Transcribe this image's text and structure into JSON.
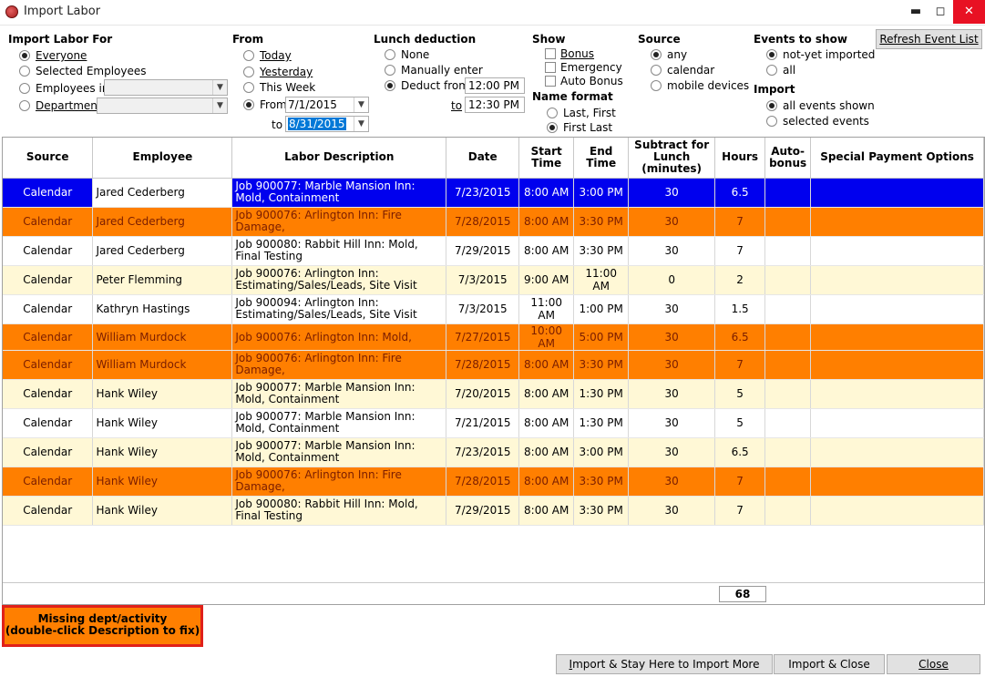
{
  "window": {
    "title": "Import Labor",
    "min": "▬",
    "max": "◻",
    "close": "✕"
  },
  "import_for": {
    "title": "Import Labor For",
    "options": [
      "Everyone",
      "Selected Employees",
      "Employees in",
      "Department"
    ],
    "selected": 0
  },
  "from": {
    "title": "From",
    "options": [
      "Today",
      "Yesterday",
      "This Week",
      "From"
    ],
    "selected": 3,
    "from_date": "7/1/2015",
    "to_label": "to",
    "to_date": "8/31/2015"
  },
  "lunch": {
    "title": "Lunch deduction",
    "options": [
      "None",
      "Manually enter",
      "Deduct from"
    ],
    "selected": 2,
    "from_time": "12:00 PM",
    "to_label": "to",
    "to_time": "12:30 PM"
  },
  "show": {
    "title": "Show",
    "checks": [
      "Bonus",
      "Emergency",
      "Auto Bonus"
    ]
  },
  "name_format": {
    "title": "Name format",
    "options": [
      "Last, First",
      "First Last"
    ],
    "selected": 1
  },
  "source": {
    "title": "Source",
    "options": [
      "any",
      "calendar",
      "mobile devices"
    ],
    "selected": 0
  },
  "events": {
    "title": "Events to show",
    "options": [
      "not-yet imported",
      "all"
    ],
    "selected": 0
  },
  "import_sel": {
    "title": "Import",
    "options": [
      "all events shown",
      "selected events"
    ],
    "selected": 0
  },
  "refresh_label": "Refresh Event List",
  "table": {
    "headers": [
      "Source",
      "Employee",
      "Labor Description",
      "Date",
      "Start Time",
      "End Time",
      "Subtract for Lunch (minutes)",
      "Hours",
      "Auto-bonus",
      "Special Payment Options"
    ],
    "rows": [
      {
        "source": "Calendar",
        "employee": "Jared Cederberg",
        "desc": "Job 900077: Marble Mansion Inn: Mold, Containment",
        "date": "7/23/2015",
        "start": "8:00 AM",
        "end": "3:00 PM",
        "lunch": "30",
        "hours": "6.5",
        "style": "sel"
      },
      {
        "source": "Calendar",
        "employee": "Jared Cederberg",
        "desc": "Job 900076: Arlington Inn: Fire Damage,",
        "date": "7/28/2015",
        "start": "8:00 AM",
        "end": "3:30 PM",
        "lunch": "30",
        "hours": "7",
        "style": "orange"
      },
      {
        "source": "Calendar",
        "employee": "Jared Cederberg",
        "desc": "Job 900080: Rabbit Hill Inn: Mold, Final Testing",
        "date": "7/29/2015",
        "start": "8:00 AM",
        "end": "3:30 PM",
        "lunch": "30",
        "hours": "7",
        "style": "white"
      },
      {
        "source": "Calendar",
        "employee": "Peter Flemming",
        "desc": "Job 900076: Arlington Inn: Estimating/Sales/Leads, Site Visit",
        "date": "7/3/2015",
        "start": "9:00 AM",
        "end": "11:00 AM",
        "lunch": "0",
        "hours": "2",
        "style": "cream"
      },
      {
        "source": "Calendar",
        "employee": "Kathryn Hastings",
        "desc": "Job 900094: Arlington Inn: Estimating/Sales/Leads, Site Visit",
        "date": "7/3/2015",
        "start": "11:00 AM",
        "end": "1:00 PM",
        "lunch": "30",
        "hours": "1.5",
        "style": "white"
      },
      {
        "source": "Calendar",
        "employee": "William Murdock",
        "desc": "Job 900076: Arlington Inn: Mold,",
        "date": "7/27/2015",
        "start": "10:00 AM",
        "end": "5:00 PM",
        "lunch": "30",
        "hours": "6.5",
        "style": "orange short"
      },
      {
        "source": "Calendar",
        "employee": "William Murdock",
        "desc": "Job 900076: Arlington Inn: Fire Damage,",
        "date": "7/28/2015",
        "start": "8:00 AM",
        "end": "3:30 PM",
        "lunch": "30",
        "hours": "7",
        "style": "orange"
      },
      {
        "source": "Calendar",
        "employee": "Hank Wiley",
        "desc": "Job 900077: Marble Mansion Inn: Mold, Containment",
        "date": "7/20/2015",
        "start": "8:00 AM",
        "end": "1:30 PM",
        "lunch": "30",
        "hours": "5",
        "style": "cream"
      },
      {
        "source": "Calendar",
        "employee": "Hank Wiley",
        "desc": "Job 900077: Marble Mansion Inn: Mold, Containment",
        "date": "7/21/2015",
        "start": "8:00 AM",
        "end": "1:30 PM",
        "lunch": "30",
        "hours": "5",
        "style": "white"
      },
      {
        "source": "Calendar",
        "employee": "Hank Wiley",
        "desc": "Job 900077: Marble Mansion Inn: Mold, Containment",
        "date": "7/23/2015",
        "start": "8:00 AM",
        "end": "3:00 PM",
        "lunch": "30",
        "hours": "6.5",
        "style": "cream"
      },
      {
        "source": "Calendar",
        "employee": "Hank Wiley",
        "desc": "Job 900076: Arlington Inn: Fire Damage,",
        "date": "7/28/2015",
        "start": "8:00 AM",
        "end": "3:30 PM",
        "lunch": "30",
        "hours": "7",
        "style": "orange"
      },
      {
        "source": "Calendar",
        "employee": "Hank Wiley",
        "desc": "Job 900080: Rabbit Hill Inn: Mold, Final Testing",
        "date": "7/29/2015",
        "start": "8:00 AM",
        "end": "3:30 PM",
        "lunch": "30",
        "hours": "7",
        "style": "cream"
      }
    ],
    "total_hours": "68"
  },
  "legend": {
    "line1": "Missing dept/activity",
    "line2": "(double-click Description to fix)"
  },
  "buttons": {
    "import_stay": "Import & Stay Here to Import More",
    "import_close": "Import & Close",
    "close": "Close"
  },
  "colors": {
    "selected": "#0000ee",
    "missing": "#ff7f00",
    "alt": "#fff8d6",
    "legend_border": "#e0201a"
  }
}
